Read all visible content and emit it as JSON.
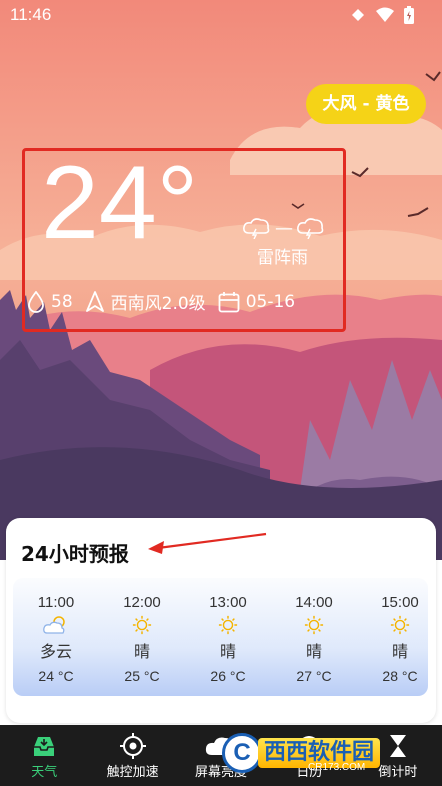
{
  "status_bar": {
    "time": "11:46",
    "icons": [
      "cast-icon",
      "wifi-icon",
      "battery-icon"
    ]
  },
  "alert": {
    "label": "大风 - 黄色"
  },
  "current": {
    "temperature": "24°",
    "condition": "雷阵雨",
    "humidity": "58",
    "wind": "西南风2.0级",
    "date": "05-16"
  },
  "forecast": {
    "title": "24小时预报",
    "hours": [
      {
        "time": "11:00",
        "icon": "partly-cloudy-icon",
        "condition": "多云",
        "temp": "24 °C"
      },
      {
        "time": "12:00",
        "icon": "sunny-icon",
        "condition": "晴",
        "temp": "25 °C"
      },
      {
        "time": "13:00",
        "icon": "sunny-icon",
        "condition": "晴",
        "temp": "26 °C"
      },
      {
        "time": "14:00",
        "icon": "sunny-icon",
        "condition": "晴",
        "temp": "27 °C"
      },
      {
        "time": "15:00",
        "icon": "sunny-icon",
        "condition": "晴",
        "temp": "28 °C"
      }
    ]
  },
  "nav": {
    "items": [
      {
        "label": "天气",
        "icon": "inbox-tray-icon",
        "active": true
      },
      {
        "label": "触控加速",
        "icon": "crosshair-icon",
        "active": false
      },
      {
        "label": "屏幕亮度",
        "icon": "cloud-icon",
        "active": false
      },
      {
        "label": "日历",
        "icon": "calendar-icon",
        "active": false
      },
      {
        "label": "倒计时",
        "icon": "hourglass-icon",
        "active": false
      }
    ]
  },
  "watermark": {
    "logo": "C",
    "text": "西西软件园",
    "sub": "CR173.COM"
  },
  "colors": {
    "alert_bg": "#f5d317",
    "highlight_border": "#e12a22",
    "nav_active": "#3ad07a",
    "nav_bg": "#1c1c1c"
  }
}
